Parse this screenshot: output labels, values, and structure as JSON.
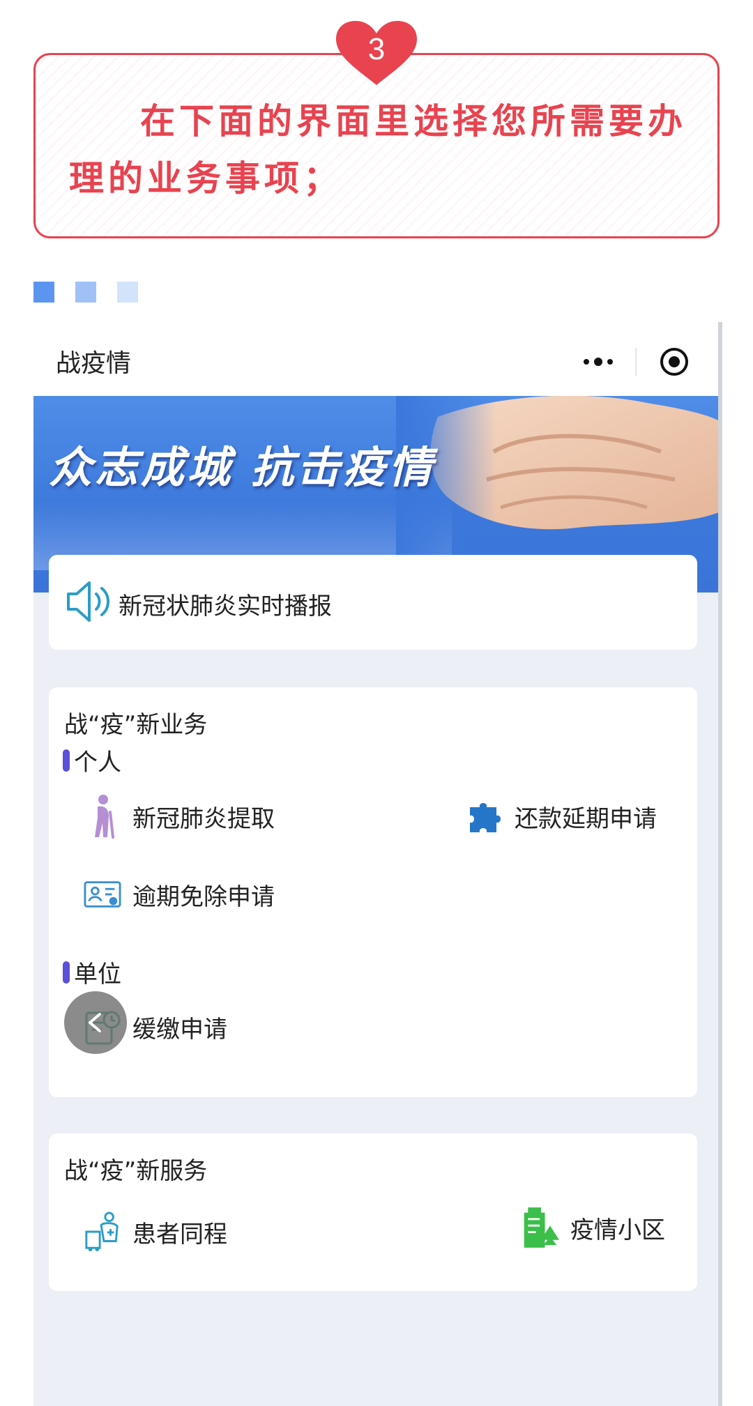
{
  "step": {
    "number": "3",
    "instruction": "在下面的界面里选择您所需要办理的业务事项；"
  },
  "decor": {
    "square_colors": [
      "#5b95f0",
      "#9fc1f6",
      "#d3e3fb"
    ]
  },
  "app": {
    "nav_title": "战疫情",
    "more_icon": "more-dots-icon",
    "close_icon": "target-circle-icon",
    "banner_slogan": "众志成城 抗击疫情",
    "broadcast_label": "新冠状肺炎实时播报",
    "business_section": {
      "title": "战“疫”新业务",
      "personal_heading": "个人",
      "personal_items": [
        {
          "label": "新冠肺炎提取",
          "icon": "elderly-person-icon"
        },
        {
          "label": "还款延期申请",
          "icon": "puzzle-icon"
        },
        {
          "label": "逾期免除申请",
          "icon": "id-card-icon"
        }
      ],
      "unit_heading": "单位",
      "unit_items": [
        {
          "label": "缓缴申请",
          "icon": "document-clock-icon"
        }
      ]
    },
    "service_section": {
      "title": "战“疫”新服务",
      "items": [
        {
          "label": "患者同程",
          "icon": "patient-travel-icon"
        },
        {
          "label": "疫情小区",
          "icon": "community-building-icon"
        }
      ]
    }
  },
  "colors": {
    "accent_red": "#e8434f",
    "banner_blue": "#3c78db",
    "section_bar": "#5a4fd6"
  }
}
